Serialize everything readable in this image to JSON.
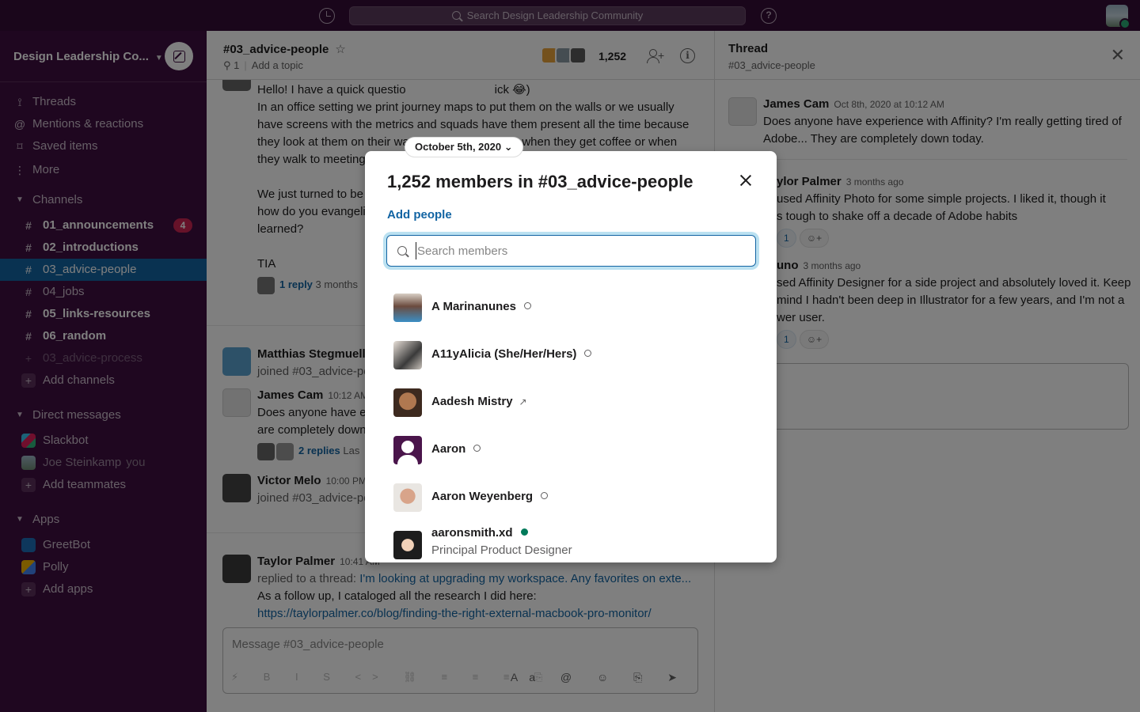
{
  "topbar": {
    "search_placeholder": "Search Design Leadership Community"
  },
  "sidebar": {
    "workspace": "Design Leadership Co...",
    "nav": [
      {
        "icon": "threads-icon",
        "label": "Threads"
      },
      {
        "icon": "at-icon",
        "label": "Mentions & reactions"
      },
      {
        "icon": "bookmark-icon",
        "label": "Saved items"
      },
      {
        "icon": "more-icon",
        "label": "More"
      }
    ],
    "channels_header": "Channels",
    "channels": [
      {
        "name": "01_announcements",
        "badge": "4"
      },
      {
        "name": "02_introductions"
      },
      {
        "name": "03_advice-people"
      },
      {
        "name": "04_jobs"
      },
      {
        "name": "05_links-resources"
      },
      {
        "name": "06_random"
      },
      {
        "name": "03_advice-process"
      }
    ],
    "add_channels": "Add channels",
    "dm_header": "Direct messages",
    "dms": [
      {
        "name": "Slackbot"
      },
      {
        "name": "Joe Steinkamp",
        "suffix": "you"
      }
    ],
    "add_teammates": "Add teammates",
    "apps_header": "Apps",
    "apps": [
      {
        "name": "GreetBot"
      },
      {
        "name": "Polly"
      }
    ],
    "add_apps": "Add apps"
  },
  "channel": {
    "name": "#03_advice-people",
    "pins": "1",
    "topic": "Add a topic",
    "member_count": "1,252",
    "date_pill": "October 5th, 2020",
    "composer_placeholder": "Message #03_advice-people",
    "messages": {
      "m1_line0a": "Hello! I have a quick questio",
      "m1_line0b": "ick 😂)",
      "m1_lines": [
        "In an office setting we print journey maps to put them on the walls or we usually",
        "have screens with the metrics and squads have them present all the time because",
        "they look at them on their way to the bathroom, or when they get coffee or when",
        "they walk to meeting"
      ],
      "m1_lines2": [
        "We just turned to be",
        "how do you evangeliz",
        "learned?"
      ],
      "m1_tia": "TIA",
      "m1_reply": "1 reply",
      "m1_reply_time": "3 months",
      "m2_name": "Matthias Stegmuelle",
      "m2_text": "joined #03_advice-pe",
      "m3_name": "James Cam",
      "m3_time": "10:12 AM",
      "m3_lines": [
        "Does anyone have ex",
        "are completely down"
      ],
      "m3_reply": "2 replies",
      "m3_reply_more": "Las",
      "m4_name": "Victor Melo",
      "m4_time": "10:00 PM",
      "m4_text": "joined #03_advice-pe",
      "m5_name": "Taylor Palmer",
      "m5_time": "10:41 AM",
      "m5_prefix": "replied to a thread:",
      "m5_link": "I'm looking at upgrading my workspace. Any favorites on exte...",
      "m5_line2": "As a follow up, I cataloged all the research I did here:",
      "m5_url": "https://taylorpalmer.co/blog/finding-the-right-external-macbook-pro-monitor/"
    }
  },
  "thread": {
    "title": "Thread",
    "channel": "#03_advice-people",
    "messages": [
      {
        "name": "James Cam",
        "time": "Oct 8th, 2020 at 10:12 AM",
        "lines": [
          "Does anyone have experience with Affinity? I'm really getting tired of",
          "Adobe... They are completely down today."
        ]
      },
      {
        "name": "ylor Palmer",
        "time": "3 months ago",
        "lines": [
          "used Affinity Photo for some simple projects. I liked it, though it",
          "s tough to shake off a decade of Adobe habits"
        ],
        "react": "1"
      },
      {
        "name": "uno",
        "time": "3 months ago",
        "lines": [
          "sed Affinity Designer for a side project and absolutely loved it. Keep",
          "mind I hadn't been deep in Illustrator for a few years, and I'm not a",
          "wer user."
        ],
        "react": "1"
      }
    ]
  },
  "modal": {
    "title": "1,252 members in #03_advice-people",
    "add_people": "Add people",
    "search_placeholder": "Search members",
    "members": [
      {
        "name": "A Marinanunes",
        "status": "away"
      },
      {
        "name": "A11yAlicia (She/Her/Hers)",
        "status": "away"
      },
      {
        "name": "Aadesh Mistry",
        "status": "external"
      },
      {
        "name": "Aaron",
        "status": "away"
      },
      {
        "name": "Aaron Weyenberg",
        "status": "away"
      },
      {
        "name": "aaronsmith.xd",
        "status": "active",
        "title": "Principal Product Designer"
      }
    ]
  },
  "colors": {
    "sidebar": "#3f0e40",
    "topbar": "#350d36",
    "selected": "#1264a3",
    "badge": "#cd2553",
    "link": "#1264a3",
    "online": "#007a5a"
  }
}
